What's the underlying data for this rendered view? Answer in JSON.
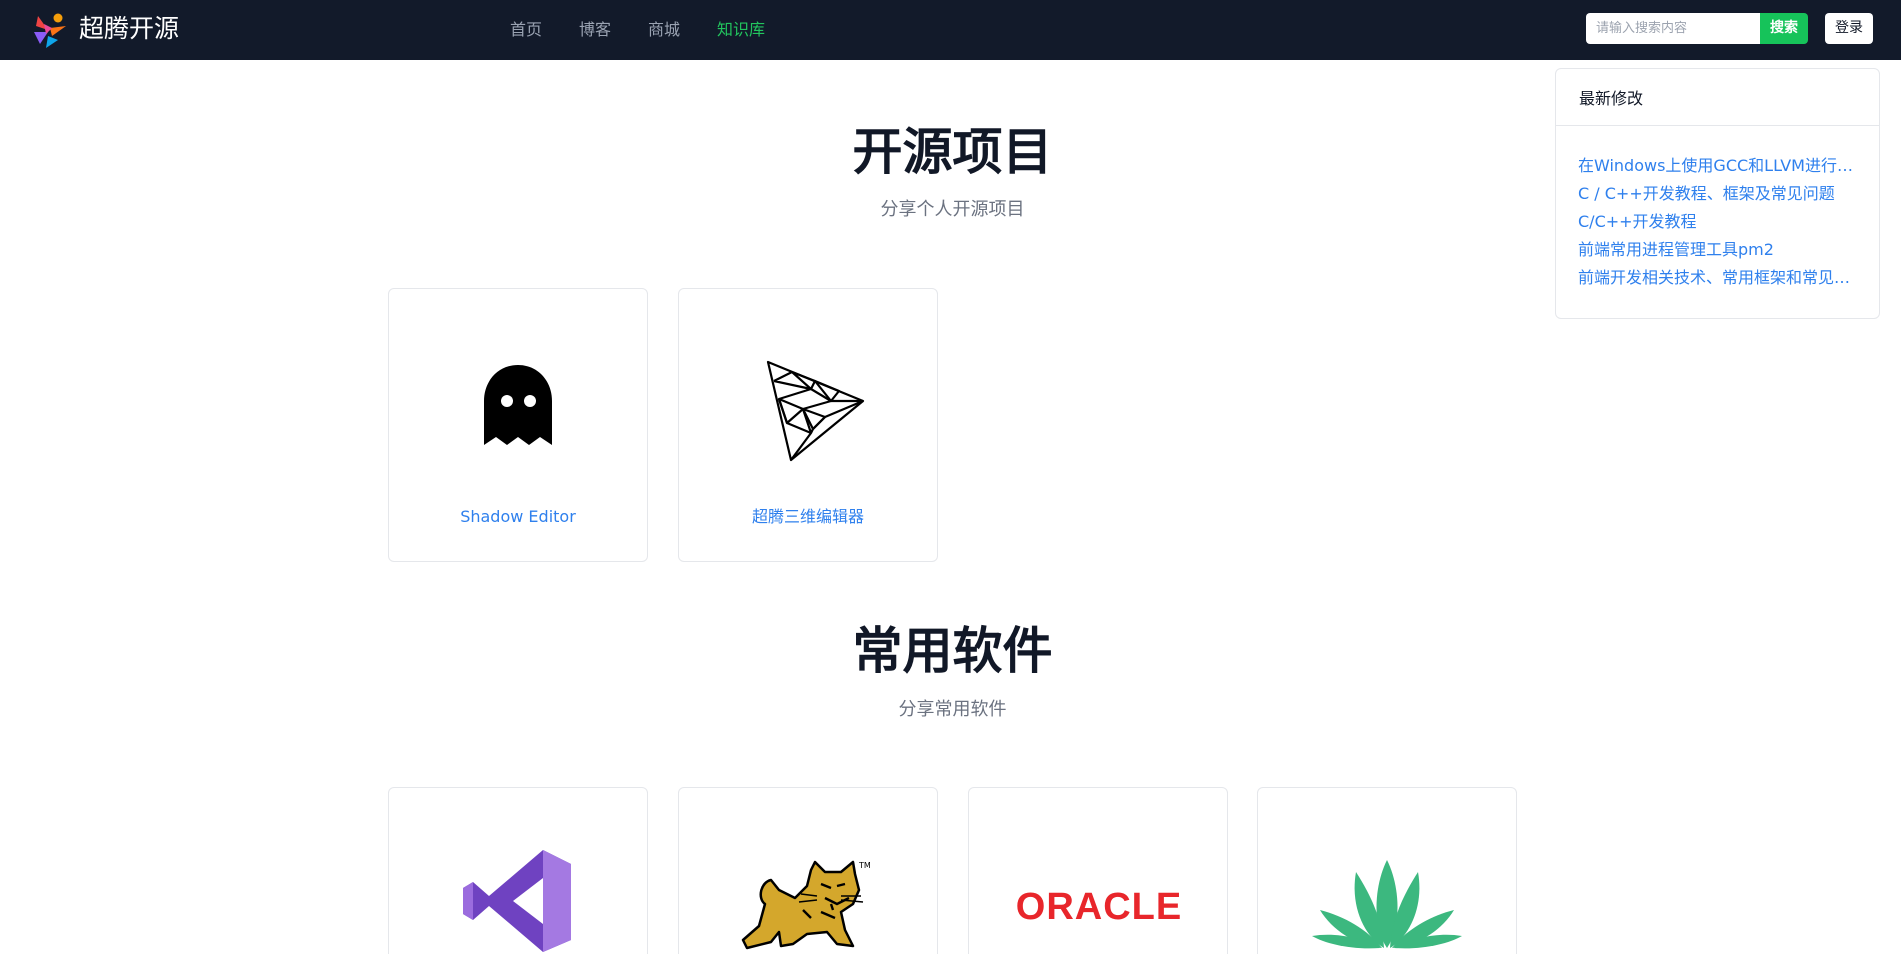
{
  "header": {
    "brand": "超腾开源",
    "nav": [
      "首页",
      "博客",
      "商城",
      "知识库"
    ],
    "active_nav": "知识库",
    "search_placeholder": "请输入搜索内容",
    "search_label": "搜索",
    "login_label": "登录"
  },
  "projects": {
    "title": "开源项目",
    "subtitle": "分享个人开源项目",
    "items": [
      {
        "label": "Shadow Editor",
        "icon": "ghost-icon"
      },
      {
        "label": "超腾三维编辑器",
        "icon": "triangle-mesh-icon"
      }
    ]
  },
  "software": {
    "title": "常用软件",
    "subtitle": "分享常用软件",
    "items": [
      {
        "icon": "visual-studio-icon"
      },
      {
        "icon": "tomcat-icon"
      },
      {
        "icon": "oracle-icon",
        "logo_text": "ORACLE"
      },
      {
        "icon": "aloe-plant-icon"
      }
    ]
  },
  "recent": {
    "title": "最新修改",
    "items": [
      "在Windows上使用GCC和LLVM进行C/C++开发",
      "C / C++开发教程、框架及常见问题",
      "C/C++开发教程",
      "前端常用进程管理工具pm2",
      "前端开发相关技术、常用框架和常见问题"
    ]
  },
  "colors": {
    "topbar": "#121a2a",
    "accent_green": "#16c35a",
    "link_blue": "#2f80ed",
    "oracle_red": "#e8262b"
  }
}
